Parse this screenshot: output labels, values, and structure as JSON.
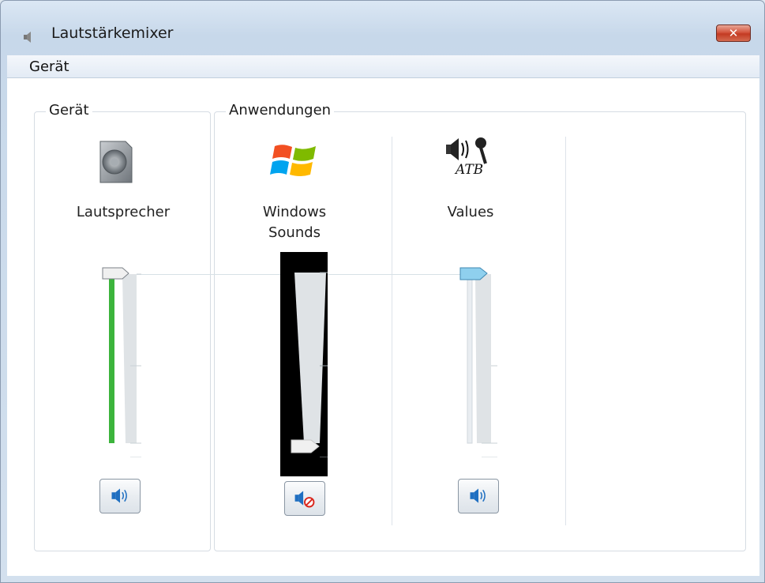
{
  "window": {
    "title": "Lautstärkemixer",
    "close_glyph": "✕"
  },
  "menu": {
    "items": [
      "Gerät"
    ]
  },
  "groups": {
    "device_label": "Gerät",
    "apps_label": "Anwendungen"
  },
  "channels": [
    {
      "name_line1": "Lautsprecher",
      "name_line2": "",
      "icon": "speaker-device-icon",
      "volume_fraction": 1.0,
      "meter_fraction": 1.0,
      "muted": false,
      "focused": false
    },
    {
      "name_line1": "Windows",
      "name_line2": "Sounds",
      "icon": "windows-logo-icon",
      "volume_fraction": 0.0,
      "meter_fraction": 0.0,
      "muted": true,
      "focused": true
    },
    {
      "name_line1": "Values",
      "name_line2": "",
      "icon": "speaker-microphone-icon",
      "icon_text": "ATB",
      "volume_fraction": 1.0,
      "meter_fraction": 0.0,
      "muted": false,
      "focused": false
    }
  ],
  "colors": {
    "meter_green": "#3cb43c",
    "thumb_active": "#8fd0ee",
    "mute_red": "#d9261c",
    "speaker_blue": "#1f6fc1"
  }
}
